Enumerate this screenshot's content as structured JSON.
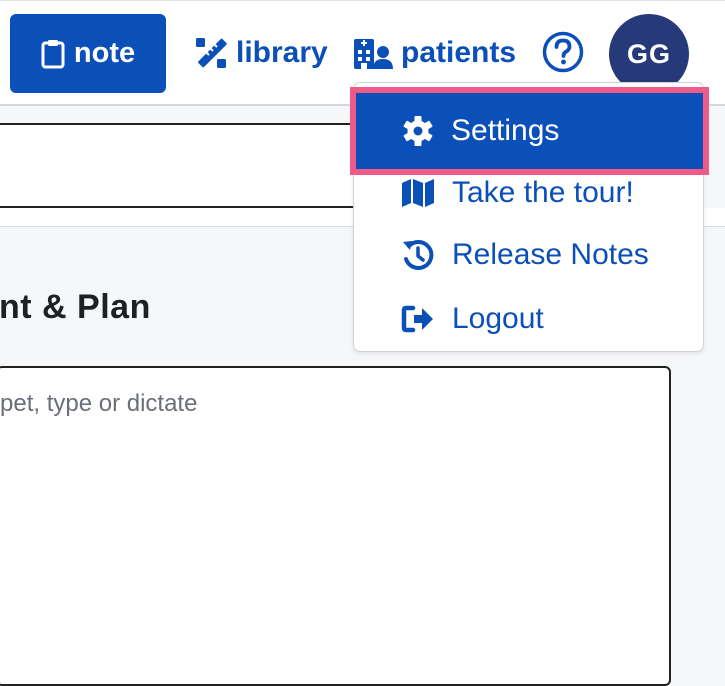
{
  "header": {
    "note_label": "note",
    "library_label": "library",
    "patients_label": "patients",
    "avatar_initials": "GG"
  },
  "user_menu": {
    "items": [
      {
        "label": "Settings",
        "icon": "gear-icon",
        "highlighted": true
      },
      {
        "label": "Take the tour!",
        "icon": "map-icon"
      },
      {
        "label": "Release Notes",
        "icon": "history-icon"
      },
      {
        "label": "Logout",
        "icon": "logout-icon"
      }
    ]
  },
  "main": {
    "section_heading": "nt & Plan",
    "editor_placeholder": "pet, type or dictate"
  },
  "colors": {
    "primary": "#0b4fb8",
    "avatar": "#263a7a",
    "highlight_outline": "#ef5b88"
  }
}
